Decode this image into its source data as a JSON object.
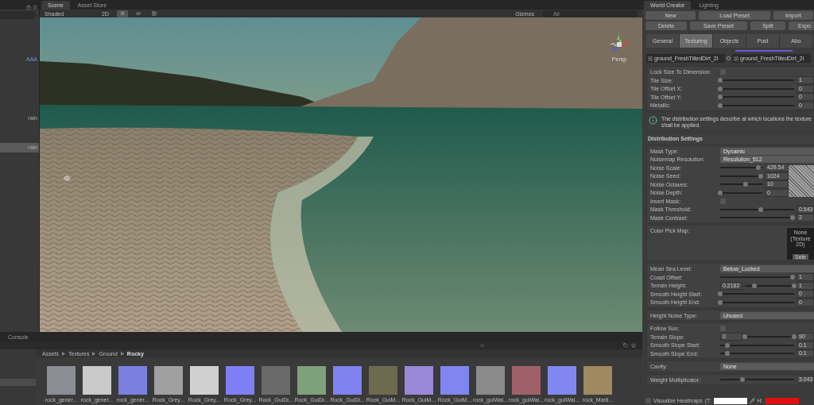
{
  "hierarchy": {
    "items": [
      {
        "label": "AAA",
        "kind": "prefab",
        "selected": false
      },
      {
        "label": "rain",
        "kind": "object",
        "selected": false
      },
      {
        "label": "rain",
        "kind": "object",
        "selected": true
      }
    ]
  },
  "scene": {
    "tabs": [
      {
        "label": "Scene",
        "selected": true
      },
      {
        "label": "Asset Store",
        "selected": false
      }
    ],
    "toolbar": {
      "draw_mode": "Shaded",
      "mode_2d": "2D",
      "lighting_on": true,
      "audio_on": false,
      "effects_on": false,
      "gizmos": "Gizmos",
      "search_placeholder": "All"
    },
    "projection": "Persp"
  },
  "project": {
    "tab": "Console",
    "breadcrumb": [
      "Assets",
      "Textures",
      "Ground",
      "Rocky"
    ],
    "assets": [
      {
        "label": "rock_gener...",
        "color": "#8a8d94"
      },
      {
        "label": "rock_gener...",
        "color": "#c9c9c9"
      },
      {
        "label": "rock_gener...",
        "color": "#7a7fe0"
      },
      {
        "label": "Rock_Grey...",
        "color": "#a0a0a0"
      },
      {
        "label": "Rock_Grey...",
        "color": "#d0d0d0"
      },
      {
        "label": "Rock_Grey...",
        "color": "#7f7ff5"
      },
      {
        "label": "Rock_GuiDi...",
        "color": "#6a6a6a"
      },
      {
        "label": "Rock_GuiDi...",
        "color": "#7ea07a"
      },
      {
        "label": "Rock_GuiDi...",
        "color": "#7f82f0"
      },
      {
        "label": "Rock_GuiM...",
        "color": "#6d6a4d"
      },
      {
        "label": "Rock_GuiM...",
        "color": "#9a88d8"
      },
      {
        "label": "Rock_GuiM...",
        "color": "#8085f0"
      },
      {
        "label": "rock_guiWal...",
        "color": "#8a8a8a"
      },
      {
        "label": "rock_guiWal...",
        "color": "#a0606a"
      },
      {
        "label": "rock_guiWal...",
        "color": "#8088f0"
      },
      {
        "label": "rock_Marti...",
        "color": "#a08860"
      }
    ]
  },
  "inspector": {
    "tabs": [
      {
        "label": "World Creator",
        "selected": true
      },
      {
        "label": "Lighting",
        "selected": false
      }
    ],
    "buttons_row1": [
      "New",
      "Load Preset",
      "Import"
    ],
    "buttons_row2": [
      "Delete",
      "Save Preset",
      "Split",
      "Expo"
    ],
    "sub_tabs": [
      {
        "label": "General",
        "selected": false
      },
      {
        "label": "Texturing",
        "selected": true
      },
      {
        "label": "Objects",
        "selected": false
      },
      {
        "label": "Post",
        "selected": false
      },
      {
        "label": "Abo",
        "selected": false
      }
    ],
    "textures": [
      "ground_FreshTilledDirt_2l",
      "ground_FreshTilledDirt_2l"
    ],
    "texture_settings": [
      {
        "kind": "checkbox",
        "label": "Lock Size To Dimension:",
        "checked": false
      },
      {
        "kind": "slider",
        "label": "Tile Size:",
        "level": 0,
        "value": "1"
      },
      {
        "kind": "slider",
        "label": "Tile Offset X:",
        "level": 0,
        "value": "0"
      },
      {
        "kind": "slider",
        "label": "Tile Offset Y:",
        "level": 0,
        "value": "0"
      },
      {
        "kind": "slider",
        "label": "Metallic:",
        "level": 0,
        "value": "0"
      }
    ],
    "info": "The distribution settings describe at which locations the texture shall be applied.",
    "distribution_title": "Distribution Settings",
    "mask_settings": [
      {
        "kind": "dropdown",
        "label": "Mask Type:",
        "value": "Dynamic"
      },
      {
        "kind": "dropdown",
        "label": "Noisemap Resolution:",
        "value": "Resolution_512"
      }
    ],
    "noise_settings": [
      {
        "label": "Noise Scale:",
        "level": 0.9,
        "value": "429.54"
      },
      {
        "label": "Noise Seed:",
        "level": 0.97,
        "value": "1024"
      },
      {
        "label": "Noise Octaves:",
        "level": 0.6,
        "value": "10"
      },
      {
        "label": "Noise Depth:",
        "level": 0,
        "value": "0"
      }
    ],
    "mask_settings_2": [
      {
        "kind": "checkbox",
        "label": "Invert Mask:",
        "checked": false
      },
      {
        "kind": "slider",
        "label": "Mask Threshold:",
        "level": 0.55,
        "value": "0.543"
      },
      {
        "kind": "slider",
        "label": "Mask Contrast:",
        "level": 0.98,
        "value": "2"
      }
    ],
    "color_pick_map": {
      "label": "Color Pick Map:",
      "value": "None (Texture 2D)",
      "button": "Sele"
    },
    "height_settings": [
      {
        "kind": "dropdown",
        "label": "Mean Sea Level:",
        "value": "Below_Locked"
      },
      {
        "kind": "slider",
        "label": "Coast Offset:",
        "level": 0.98,
        "value": "1"
      },
      {
        "kind": "range",
        "label": "Terrain Height:",
        "min": "0.2162",
        "max": "1",
        "level": 0.2
      },
      {
        "kind": "slider",
        "label": "Smooth Height Start:",
        "level": 0,
        "value": "0"
      },
      {
        "kind": "slider",
        "label": "Smooth Height End:",
        "level": 0,
        "value": "0"
      }
    ],
    "height_noise": [
      {
        "kind": "dropdown",
        "label": "Height Noise Type:",
        "value": "Unused"
      }
    ],
    "slope_settings": [
      {
        "kind": "checkbox",
        "label": "Follow Sun:",
        "checked": false
      },
      {
        "kind": "range",
        "label": "Terrain Slope:",
        "min": "0",
        "max": "90",
        "level": 0
      },
      {
        "kind": "slider",
        "label": "Smooth Slope Start:",
        "level": 0.1,
        "value": "0.1"
      },
      {
        "kind": "slider",
        "label": "Smooth Slope End:",
        "level": 0.1,
        "value": "0.1"
      }
    ],
    "cavity": [
      {
        "kind": "dropdown",
        "label": "Cavity:",
        "value": "None"
      }
    ],
    "weight": [
      {
        "kind": "slider",
        "label": "Weight Multiplicator:",
        "level": 0.3,
        "value": "3.043"
      }
    ],
    "heatmap": {
      "label": "Visualize Heatmaps",
      "checked": false,
      "t_label": "(T:",
      "h_label": "H:"
    }
  }
}
